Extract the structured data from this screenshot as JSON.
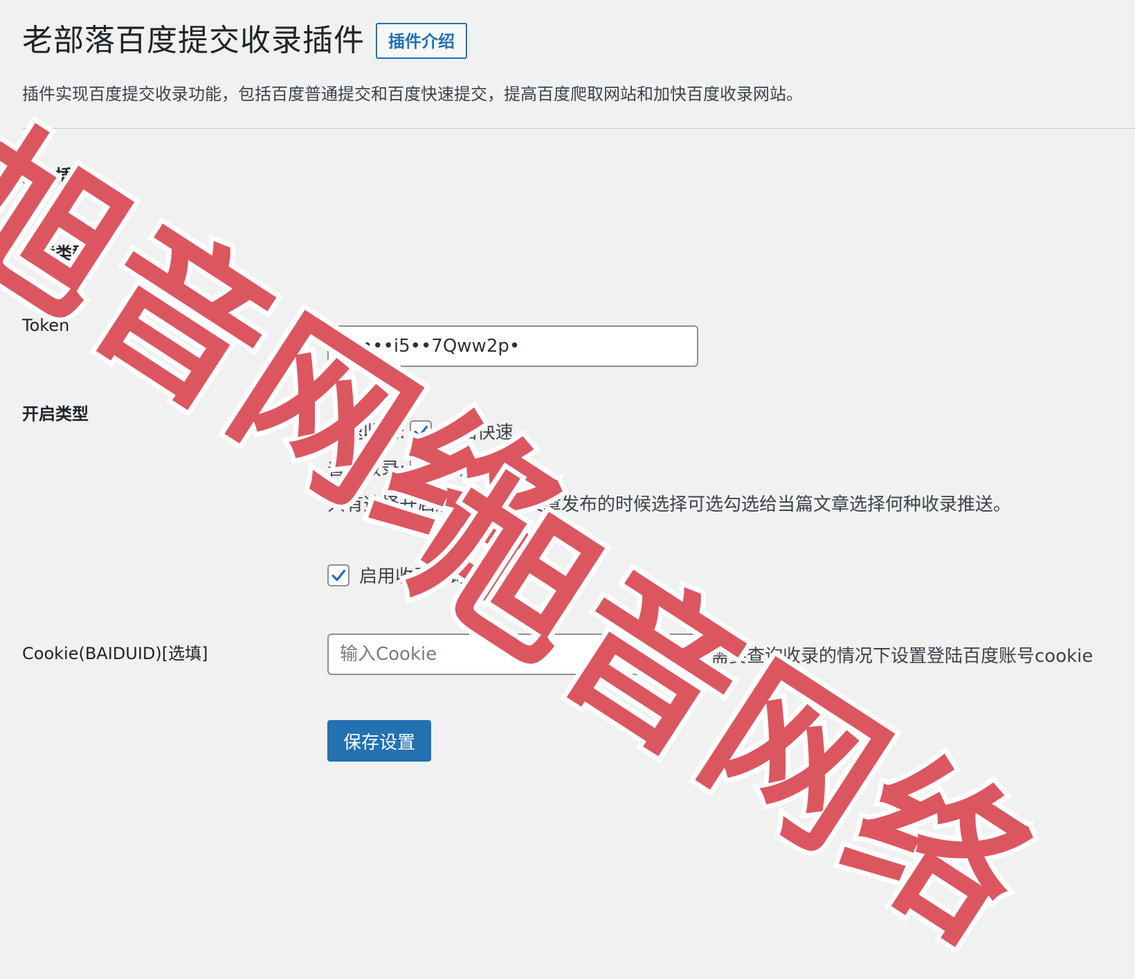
{
  "header": {
    "title": "老部落百度提交收录插件",
    "intro_button": "插件介绍",
    "description": "插件实现百度提交收录功能，包括百度普通提交和百度快速提交，提高百度爬取网站和加快百度收录网站。"
  },
  "form": {
    "enable_plugin": {
      "label": "开启插件"
    },
    "post_type": {
      "label": "文章类型"
    },
    "token": {
      "label": "Token",
      "value": "b••••i5••7Qww2p•"
    },
    "enable_type": {
      "label": "开启类型",
      "fast": {
        "label": "快速收录:",
        "option": "开启快速",
        "checked": true
      },
      "normal": {
        "label": "普通收录:",
        "option": "开启自动",
        "checked": false
      },
      "help": "只有选择开启后，才能在文章发布的时候选择可选勾选给当篇文章选择何种收录推送。"
    },
    "query": {
      "label": "启用收录查询功能",
      "checked": true
    },
    "cookie": {
      "label": "Cookie(BAIDUID)[选填]",
      "placeholder": "输入Cookie",
      "help": "需要查询收录的情况下设置登陆百度账号cookie"
    },
    "save_button": "保存设置"
  },
  "watermark": {
    "text": "旭音网络"
  },
  "colors": {
    "accent": "#2271b1",
    "watermark": "#dc5660",
    "background": "#f1f1f1"
  }
}
